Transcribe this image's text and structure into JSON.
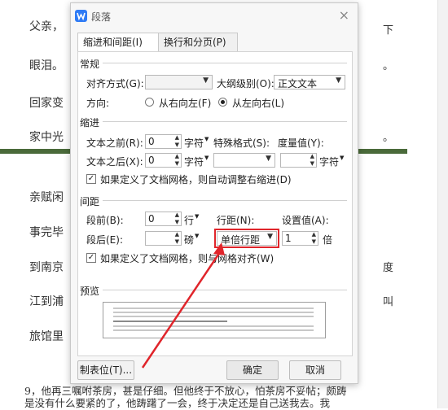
{
  "background_doc": {
    "left_lines": [
      "父亲，",
      "眼泪。",
      "回家变",
      "家中光",
      "亲赋闲",
      "事完毕",
      "到南京",
      "江到浦",
      "旅馆里"
    ],
    "right_fragments": [
      "下",
      "。",
      "。",
      "度",
      "叫"
    ],
    "bottom_lines": [
      "9，他再三嘱咐茶房，甚是仔细。但他终于不放心，怕茶房不妥帖；颇踌",
      "是没有什么要紧的了，他踌躇了一会，终于决定还是自己送我去。我"
    ]
  },
  "dialog": {
    "title": "段落",
    "close_label": "×",
    "tabs": [
      {
        "label": "缩进和间距(I)",
        "active": true
      },
      {
        "label": "换行和分页(P)",
        "active": false
      }
    ],
    "general": {
      "section": "常规",
      "align_label": "对齐方式(G):",
      "align_value": "",
      "outline_label": "大纲级别(O):",
      "outline_value": "正文文本",
      "direction_label": "方向:",
      "rtl_label": "从右向左(F)",
      "ltr_label": "从左向右(L)",
      "selected_direction": "ltr"
    },
    "indent": {
      "section": "缩进",
      "before_label": "文本之前(R):",
      "before_value": "0",
      "before_unit": "字符",
      "special_label": "特殊格式(S):",
      "special_value": "",
      "measure_label": "度量值(Y):",
      "after_label": "文本之后(X):",
      "after_value": "0",
      "after_unit": "字符",
      "measure_value": "",
      "measure_unit": "字符",
      "auto_adjust_label": "如果定义了文档网格，则自动调整右缩进(D)",
      "auto_adjust_checked": true
    },
    "spacing": {
      "section": "间距",
      "before_label": "段前(B):",
      "before_value": "0",
      "before_unit": "行",
      "line_spacing_label": "行距(N):",
      "set_value_label": "设置值(A):",
      "after_label": "段后(E):",
      "after_value": "",
      "after_unit": "磅",
      "line_spacing_value": "单倍行距",
      "set_value": "1",
      "set_value_unit": "倍",
      "grid_align_label": "如果定义了文档网格，则与网格对齐(W)",
      "grid_align_checked": true
    },
    "preview": {
      "section": "预览"
    },
    "buttons": {
      "tabs": "制表位(T)...",
      "ok": "确定",
      "cancel": "取消"
    }
  },
  "colors": {
    "highlight": "#e0252b",
    "app_icon": "#2f7bf5"
  }
}
